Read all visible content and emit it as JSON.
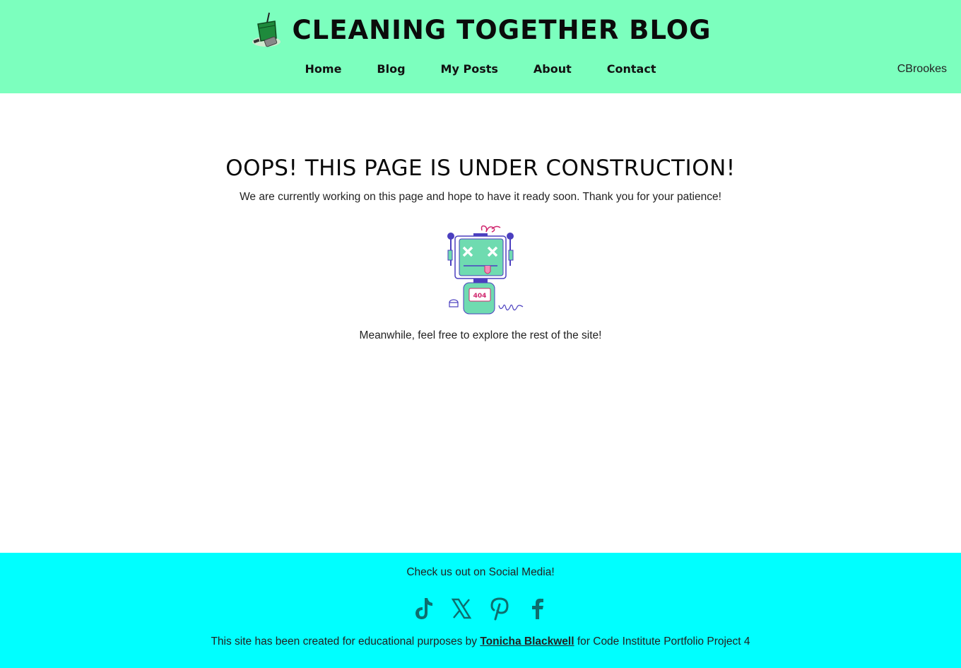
{
  "header": {
    "title": "CLEANING TOGETHER BLOG",
    "logo_icon": "cleaning-bucket-icon",
    "bg_color": "#7cffbe",
    "nav": [
      {
        "label": "Home"
      },
      {
        "label": "Blog"
      },
      {
        "label": "My Posts"
      },
      {
        "label": "About"
      },
      {
        "label": "Contact"
      }
    ],
    "username": "CBrookes"
  },
  "main": {
    "heading": "OOPS! THIS PAGE IS UNDER CONSTRUCTION!",
    "intro": "We are currently working on this page and hope to have it ready soon. Thank you for your patience!",
    "robot_badge": "404",
    "explore": "Meanwhile, feel free to explore the rest of the site!"
  },
  "footer": {
    "bg_color": "#00ffff",
    "social_heading": "Check us out on Social Media!",
    "social_icons": [
      "tiktok-icon",
      "x-icon",
      "pinterest-icon",
      "facebook-icon"
    ],
    "credit_prefix": "This site has been created for educational purposes by ",
    "credit_author": "Tonicha Blackwell",
    "credit_suffix": " for Code Institute Portfolio Project 4"
  }
}
